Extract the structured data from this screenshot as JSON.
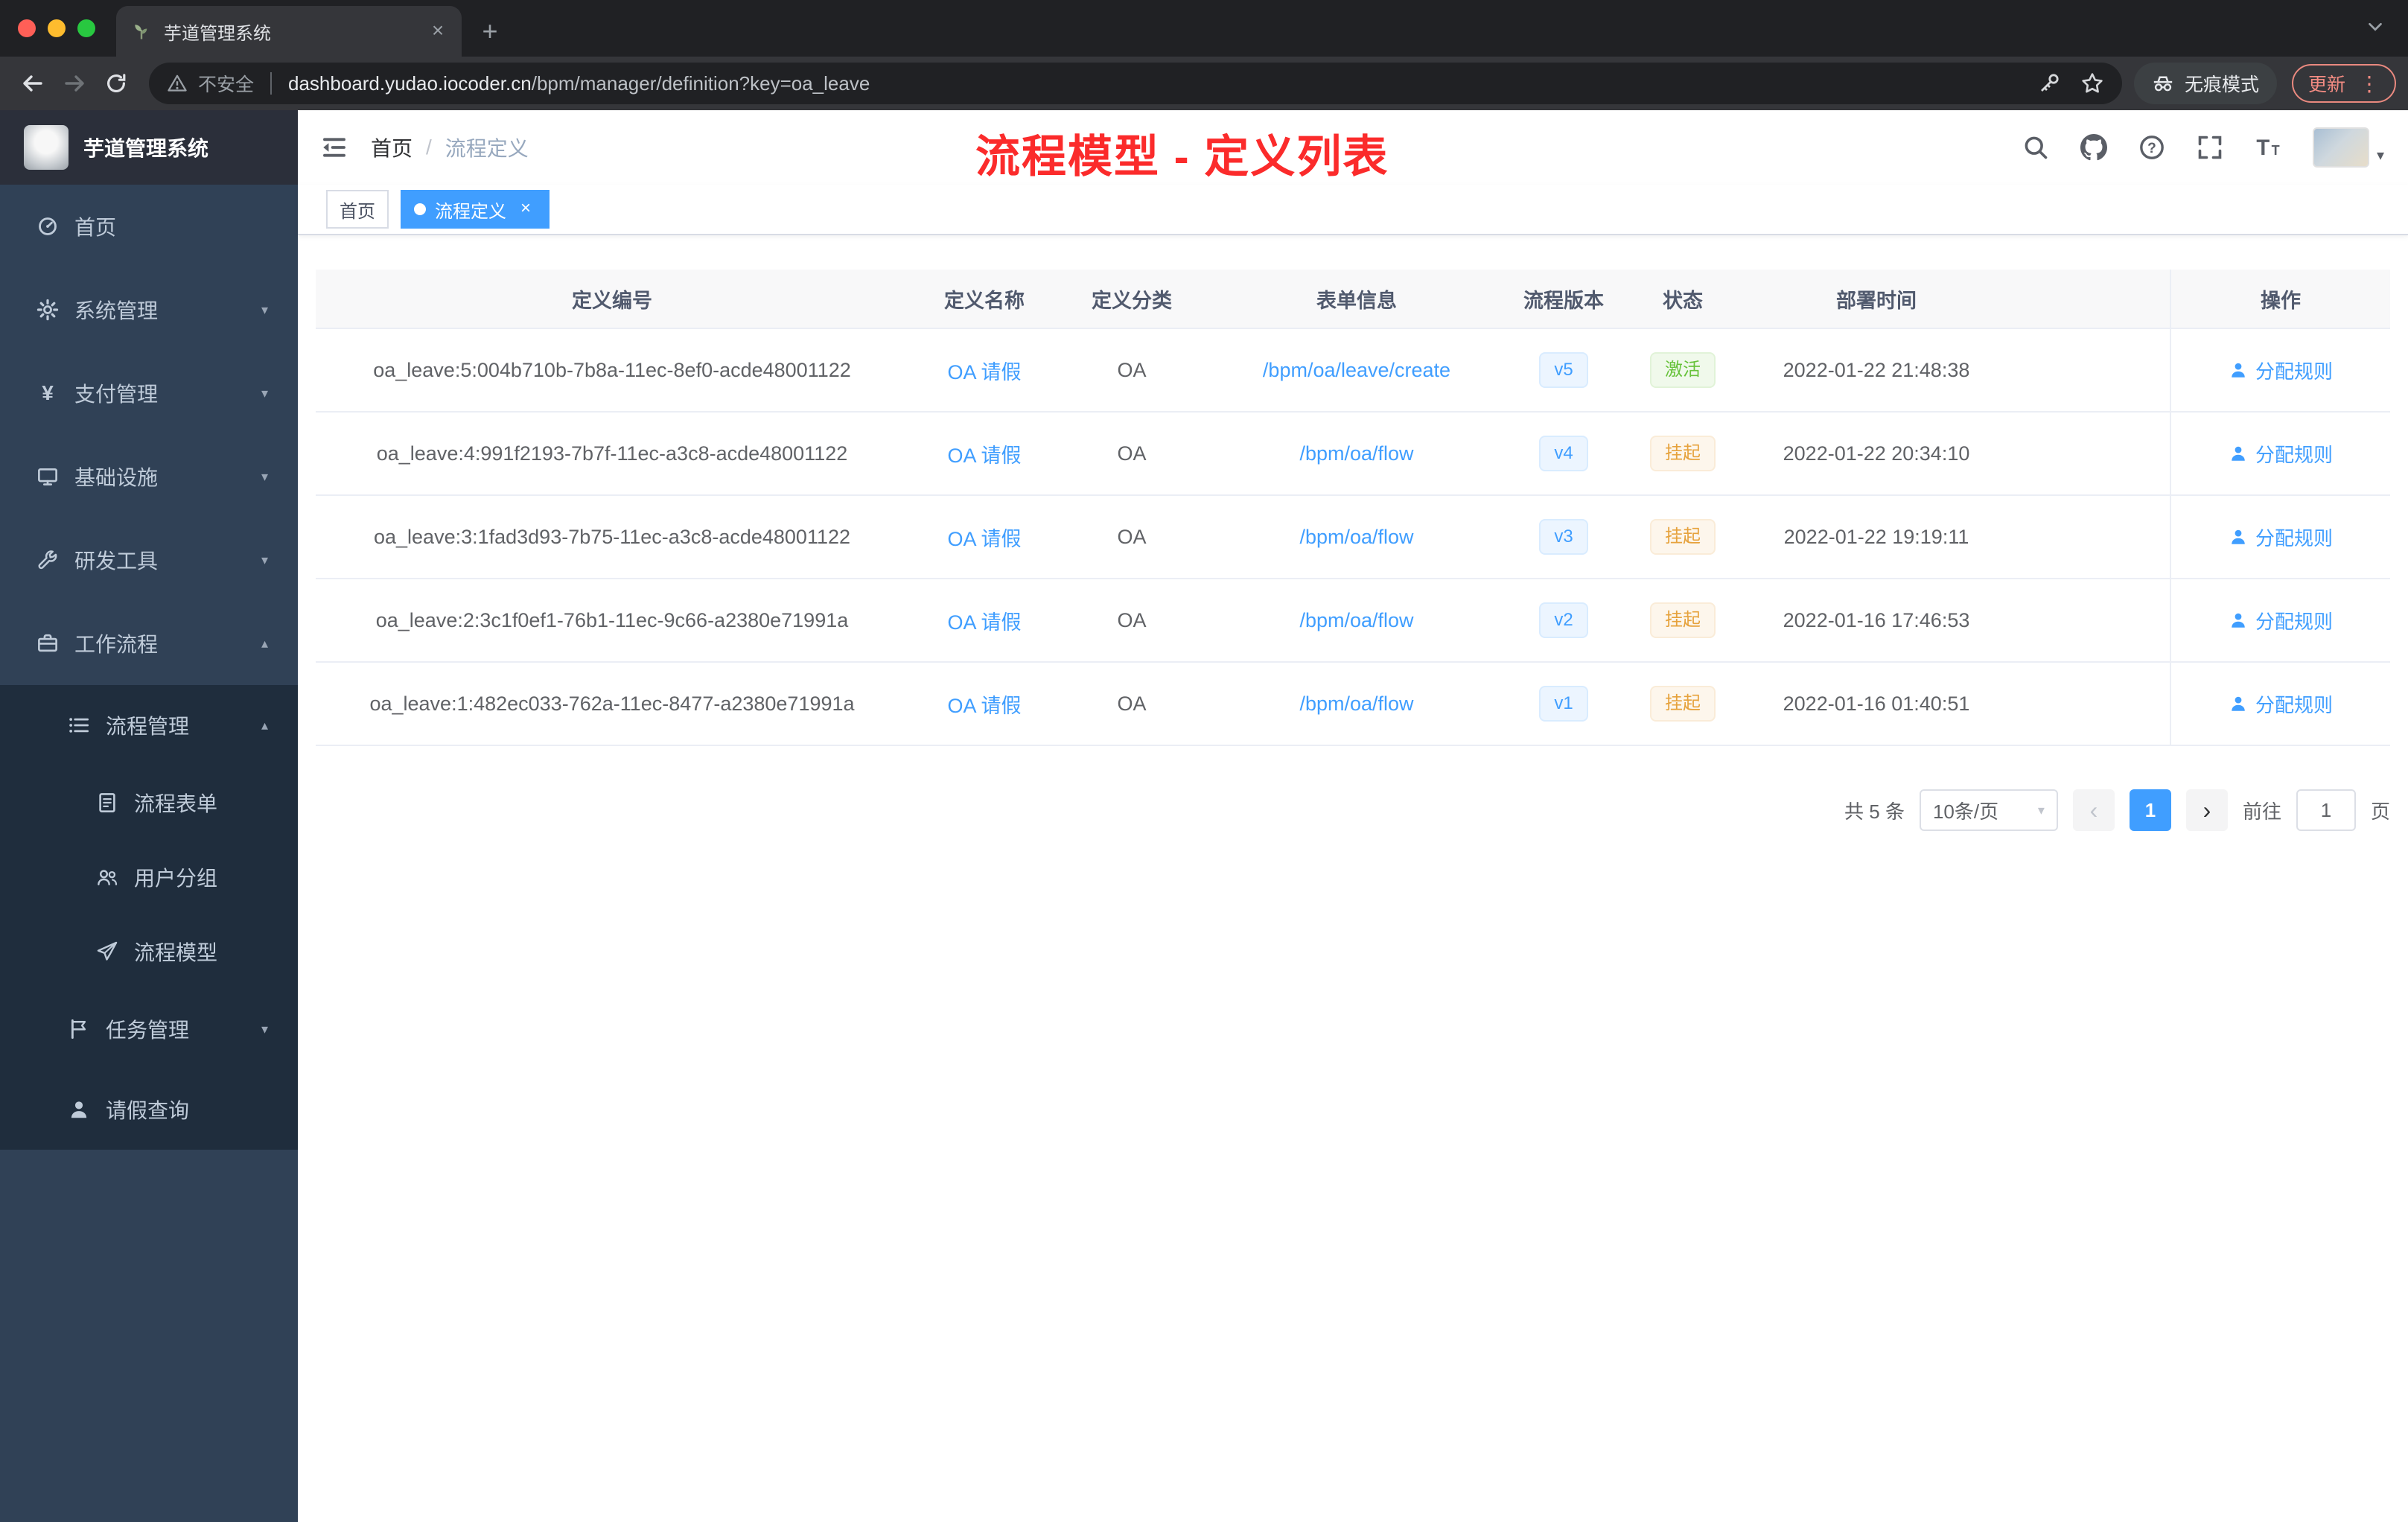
{
  "colors": {
    "accent": "#409eff",
    "success": "#67c23a",
    "warning": "#e6a23c",
    "annotation": "#fb2b2b",
    "sidebar_bg": "#304156",
    "submenu_bg": "#1f2d3d"
  },
  "browser": {
    "tab_title": "芋道管理系统",
    "security_label": "不安全",
    "url_host": "dashboard.yudao.iocoder.cn",
    "url_path": "/bpm/manager/definition?key=oa_leave",
    "incognito_label": "无痕模式",
    "update_label": "更新"
  },
  "sidebar": {
    "title": "芋道管理系统",
    "items": [
      {
        "key": "home",
        "label": "首页",
        "icon": "dashboard",
        "level": 0
      },
      {
        "key": "system",
        "label": "系统管理",
        "icon": "gear",
        "level": 0,
        "chevron": "down"
      },
      {
        "key": "payment",
        "label": "支付管理",
        "icon": "yen",
        "level": 0,
        "chevron": "down"
      },
      {
        "key": "infrastructure",
        "label": "基础设施",
        "icon": "monitor",
        "level": 0,
        "chevron": "down"
      },
      {
        "key": "devtools",
        "label": "研发工具",
        "icon": "wrench",
        "level": 0,
        "chevron": "down"
      },
      {
        "key": "workflow",
        "label": "工作流程",
        "icon": "briefcase",
        "level": 0,
        "chevron": "up"
      },
      {
        "key": "process-management",
        "label": "流程管理",
        "icon": "list",
        "level": 1,
        "sub": true,
        "chevron": "up"
      },
      {
        "key": "process-form",
        "label": "流程表单",
        "icon": "document",
        "level": 2,
        "sub": true
      },
      {
        "key": "user-group",
        "label": "用户分组",
        "icon": "users",
        "level": 2,
        "sub": true
      },
      {
        "key": "process-model",
        "label": "流程模型",
        "icon": "plane",
        "level": 2,
        "sub": true
      },
      {
        "key": "task-management",
        "label": "任务管理",
        "icon": "flag",
        "level": 1,
        "sub": true,
        "chevron": "down"
      },
      {
        "key": "leave-query",
        "label": "请假查询",
        "icon": "user",
        "level": 1,
        "sub": true
      }
    ]
  },
  "header": {
    "breadcrumb": {
      "home": "首页",
      "separator": "/",
      "current": "流程定义"
    },
    "annotation": "流程模型 - 定义列表"
  },
  "tags": [
    {
      "label": "首页",
      "active": false,
      "closable": false
    },
    {
      "label": "流程定义",
      "active": true,
      "closable": true
    }
  ],
  "table": {
    "columns": [
      "定义编号",
      "定义名称",
      "定义分类",
      "表单信息",
      "流程版本",
      "状态",
      "部署时间",
      "操作"
    ],
    "rows": [
      {
        "id": "oa_leave:5:004b710b-7b8a-11ec-8ef0-acde48001122",
        "name": "OA 请假",
        "category": "OA",
        "form": "/bpm/oa/leave/create",
        "version": "v5",
        "status": "激活",
        "status_type": "success",
        "deployed_at": "2022-01-22 21:48:38",
        "action": "分配规则"
      },
      {
        "id": "oa_leave:4:991f2193-7b7f-11ec-a3c8-acde48001122",
        "name": "OA 请假",
        "category": "OA",
        "form": "/bpm/oa/flow",
        "version": "v4",
        "status": "挂起",
        "status_type": "warning",
        "deployed_at": "2022-01-22 20:34:10",
        "action": "分配规则"
      },
      {
        "id": "oa_leave:3:1fad3d93-7b75-11ec-a3c8-acde48001122",
        "name": "OA 请假",
        "category": "OA",
        "form": "/bpm/oa/flow",
        "version": "v3",
        "status": "挂起",
        "status_type": "warning",
        "deployed_at": "2022-01-22 19:19:11",
        "action": "分配规则"
      },
      {
        "id": "oa_leave:2:3c1f0ef1-76b1-11ec-9c66-a2380e71991a",
        "name": "OA 请假",
        "category": "OA",
        "form": "/bpm/oa/flow",
        "version": "v2",
        "status": "挂起",
        "status_type": "warning",
        "deployed_at": "2022-01-16 17:46:53",
        "action": "分配规则"
      },
      {
        "id": "oa_leave:1:482ec033-762a-11ec-8477-a2380e71991a",
        "name": "OA 请假",
        "category": "OA",
        "form": "/bpm/oa/flow",
        "version": "v1",
        "status": "挂起",
        "status_type": "warning",
        "deployed_at": "2022-01-16 01:40:51",
        "action": "分配规则"
      }
    ]
  },
  "pagination": {
    "total": "共 5 条",
    "page_size": "10条/页",
    "current_page": "1",
    "goto_label": "前往",
    "page_unit": "页",
    "jump_value": "1"
  }
}
